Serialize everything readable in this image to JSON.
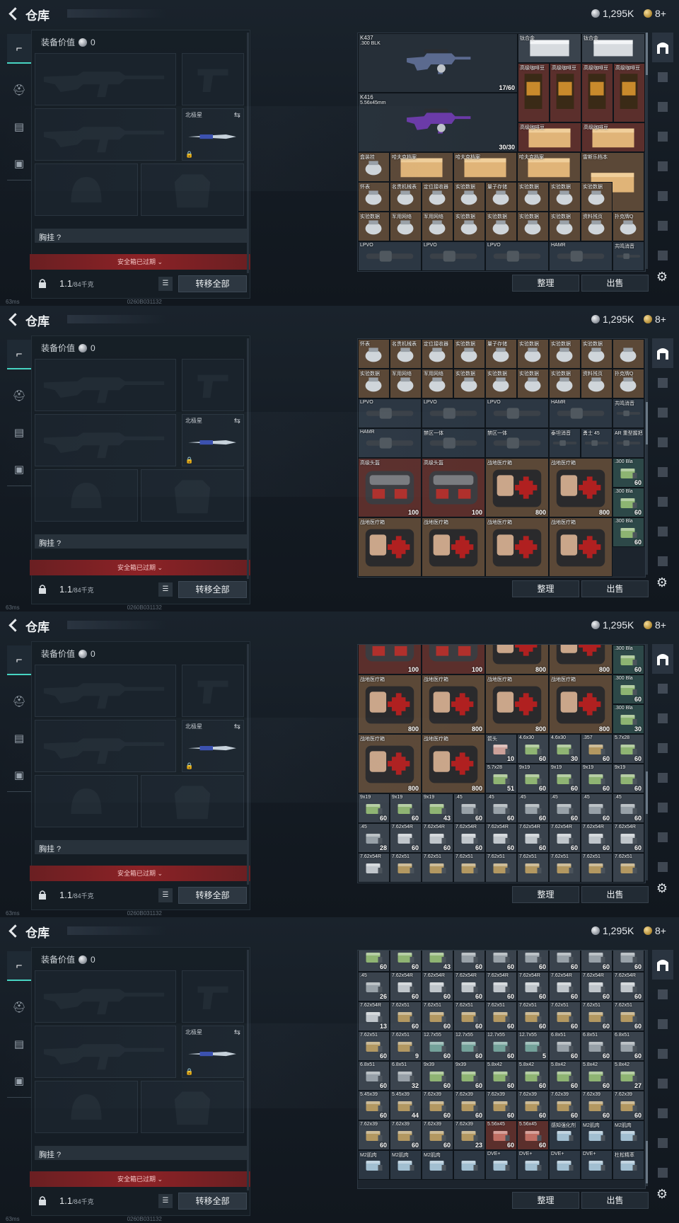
{
  "topbar": {
    "title": "仓库",
    "silver": "1,295K",
    "gold": "8+"
  },
  "left": {
    "equip_value_label": "装备价值",
    "equip_value": "0",
    "secondary_slot_label": "北极星",
    "vest_label": "胸挂 ?",
    "safe_box": "安全箱已过期",
    "weight": "1.1",
    "weight_max": "/84千克",
    "transfer_all": "转移全部"
  },
  "status": {
    "ping": "63ms",
    "uid": "0260B031132"
  },
  "buttons": {
    "sort": "整理",
    "sell": "出售"
  },
  "panels": [
    {
      "scroll_pos": 0.0,
      "cells": [
        {
          "c": 0,
          "r": 0,
          "w": 5,
          "h": 4,
          "t": "K437",
          "s": ".300 BLK",
          "n": "17/60",
          "k": "weapon"
        },
        {
          "c": 0,
          "r": 4,
          "w": 5,
          "h": 4,
          "t": "K416",
          "s": "5.56x45mm",
          "n": "30/30",
          "k": "weapon"
        },
        {
          "c": 5,
          "r": 0,
          "w": 2,
          "h": 1,
          "t": "钛合金",
          "k": "grey"
        },
        {
          "c": 7,
          "r": 0,
          "w": 2,
          "h": 1,
          "t": "钛合金",
          "k": "grey"
        },
        {
          "c": 5,
          "r": 1,
          "w": 1,
          "h": 2,
          "t": "高级咖啡豆",
          "k": "red"
        },
        {
          "c": 6,
          "r": 1,
          "w": 1,
          "h": 2,
          "t": "高级咖啡豆",
          "k": "red"
        },
        {
          "c": 7,
          "r": 1,
          "w": 1,
          "h": 2,
          "t": "高级咖啡豆",
          "k": "red"
        },
        {
          "c": 8,
          "r": 1,
          "w": 1,
          "h": 2,
          "t": "高级咖啡豆",
          "k": "red"
        },
        {
          "c": 5,
          "r": 3,
          "w": 2,
          "h": 1,
          "t": "高级咖啡豆",
          "k": "red"
        },
        {
          "c": 7,
          "r": 3,
          "w": 2,
          "h": 1,
          "t": "高级咖啡豆",
          "k": "red"
        },
        {
          "c": 0,
          "r": 4,
          "w": 1,
          "h": 1,
          "t": "",
          "k": "none"
        },
        {
          "c": 0,
          "r": 5,
          "w": 1,
          "h": 1,
          "t": "盒装挂",
          "k": "brown"
        },
        {
          "c": 1,
          "r": 5,
          "w": 2,
          "h": 1,
          "t": "哈夫克档案",
          "k": "brown"
        },
        {
          "c": 3,
          "r": 5,
          "w": 2,
          "h": 1,
          "t": "哈夫克档案",
          "k": "brown"
        },
        {
          "c": 5,
          "r": 5,
          "w": 2,
          "h": 1,
          "t": "哈夫克档案",
          "k": "brown"
        },
        {
          "c": 7,
          "r": 5,
          "w": 1,
          "h": 2,
          "t": "雷斯乐档本",
          "k": "brown"
        }
      ]
    }
  ],
  "panel_rows": [
    [
      {
        "c": 0,
        "r": 6,
        "t": "怀表",
        "k": "brown"
      },
      {
        "c": 1,
        "r": 6,
        "t": "名贵机械表",
        "k": "brown"
      },
      {
        "c": 2,
        "r": 6,
        "t": "定位接收器",
        "k": "brown"
      },
      {
        "c": 3,
        "r": 6,
        "t": "实验数据",
        "k": "brown"
      },
      {
        "c": 4,
        "r": 6,
        "t": "量子存储",
        "k": "brown"
      },
      {
        "c": 5,
        "r": 6,
        "t": "实验数据",
        "k": "brown"
      },
      {
        "c": 6,
        "r": 6,
        "t": "实验数据",
        "k": "brown"
      },
      {
        "c": 7,
        "r": 6,
        "t": "实验数据",
        "k": "brown"
      },
      {
        "c": 0,
        "r": 7,
        "t": "实验数据",
        "k": "brown"
      },
      {
        "c": 1,
        "r": 7,
        "t": "军用网络",
        "k": "brown"
      },
      {
        "c": 2,
        "r": 7,
        "t": "军用网络",
        "k": "brown"
      },
      {
        "c": 3,
        "r": 7,
        "t": "实验数据",
        "k": "brown"
      },
      {
        "c": 4,
        "r": 7,
        "t": "实验数据",
        "k": "brown"
      },
      {
        "c": 5,
        "r": 7,
        "t": "实验数据",
        "k": "brown"
      },
      {
        "c": 6,
        "r": 7,
        "t": "实验数据",
        "k": "brown"
      },
      {
        "c": 7,
        "r": 7,
        "t": "资料残页",
        "k": "brown"
      },
      {
        "c": 8,
        "r": 7,
        "t": "扑克牌Q",
        "k": "brown"
      },
      {
        "c": 0,
        "r": 8,
        "t": "LPVO",
        "k": "blue"
      },
      {
        "c": 2,
        "r": 8,
        "t": "LPVO",
        "k": "blue"
      },
      {
        "c": 4,
        "r": 8,
        "t": "LPVO",
        "k": "blue"
      },
      {
        "c": 6,
        "r": 8,
        "t": "HAMR",
        "k": "blue"
      },
      {
        "c": 8,
        "r": 8,
        "t": "共鸣消音",
        "k": "blue"
      }
    ]
  ],
  "p2": {
    "rows": [
      {
        "r": 0,
        "items": [
          [
            "怀表",
            "brown"
          ],
          [
            "名贵机械表",
            "brown"
          ],
          [
            "定位接收器",
            "brown"
          ],
          [
            "实验数据",
            "brown"
          ],
          [
            "量子存储",
            "brown"
          ],
          [
            "实验数据",
            "brown"
          ],
          [
            "实验数据",
            "brown"
          ],
          [
            "实验数据",
            "brown"
          ],
          [
            "",
            "brown"
          ]
        ]
      },
      {
        "r": 1,
        "items": [
          [
            "实验数据",
            "brown"
          ],
          [
            "军用网络",
            "brown"
          ],
          [
            "军用网络",
            "brown"
          ],
          [
            "实验数据",
            "brown"
          ],
          [
            "实验数据",
            "brown"
          ],
          [
            "实验数据",
            "brown"
          ],
          [
            "实验数据",
            "brown"
          ],
          [
            "资料残页",
            "brown"
          ],
          [
            "扑克牌Q",
            "brown"
          ]
        ]
      }
    ],
    "row2": [
      [
        "LPVO",
        0
      ],
      [
        "LPVO",
        2
      ],
      [
        "LPVO",
        4
      ],
      [
        "HAMR",
        6
      ],
      [
        "共鸣消音",
        8
      ]
    ],
    "row3": [
      [
        "HAMR",
        0
      ],
      [
        "禁区一体",
        2
      ],
      [
        "禁区一体",
        4
      ],
      [
        "泰坦消音",
        6
      ],
      [
        "勇士 45",
        7
      ],
      [
        "AR 重型握把",
        8
      ]
    ],
    "helmets": [
      [
        "高级头盔",
        "100"
      ],
      [
        "高级头盔",
        "100"
      ]
    ],
    "meds": [
      [
        "战地医疗箱",
        "800"
      ],
      [
        "战地医疗箱",
        "800"
      ]
    ],
    "meds2": [
      [
        "战地医疗箱",
        ""
      ],
      [
        "战地医疗箱",
        ""
      ],
      [
        "战地医疗箱",
        ""
      ],
      [
        "战地医疗箱",
        ""
      ]
    ],
    "ammo": [
      [
        ".300 Bla",
        "60"
      ],
      [
        ".300 Bla",
        "60"
      ],
      [
        ".300 Bla",
        "60"
      ]
    ]
  },
  "p3": {
    "medrow1": [
      [
        "",
        "100"
      ],
      [
        "",
        "100"
      ],
      [
        "",
        "800"
      ],
      [
        "",
        "800"
      ]
    ],
    "medrow2": [
      [
        "战地医疗箱",
        "800"
      ],
      [
        "战地医疗箱",
        "800"
      ],
      [
        "战地医疗箱",
        "800"
      ],
      [
        "战地医疗箱",
        "800"
      ]
    ],
    "medrow3": [
      [
        "战地医疗箱",
        "800"
      ],
      [
        "战地医疗箱",
        "800"
      ]
    ],
    "ammo_right": [
      [
        ".300 Bla",
        "60"
      ],
      [
        ".300 Bla",
        "60"
      ],
      [
        ".300 Bla",
        "30"
      ]
    ],
    "smallA": [
      [
        "箭头",
        "10",
        "pink"
      ],
      [
        "4.6x30",
        "60",
        "green"
      ],
      [
        "4.6x30",
        "30",
        "green"
      ],
      [
        ".357",
        "60",
        "tan"
      ],
      [
        "5.7x28",
        "60",
        "green"
      ]
    ],
    "smallB": [
      [
        "5.7x28",
        "51",
        "green"
      ],
      [
        "9x19",
        "60",
        "green"
      ],
      [
        "9x19",
        "60",
        "green"
      ],
      [
        "9x19",
        "60",
        "green"
      ],
      [
        "9x19",
        "60",
        "green"
      ]
    ],
    "smallC": [
      [
        "9x19",
        "60",
        "green"
      ],
      [
        "9x19",
        "60",
        "green"
      ],
      [
        "9x19",
        "43",
        "green"
      ],
      [
        ".45",
        "60",
        "grey"
      ],
      [
        ".45",
        "60",
        "grey"
      ],
      [
        ".45",
        "60",
        "grey"
      ],
      [
        ".45",
        "60",
        "grey"
      ],
      [
        ".45",
        "60",
        "grey"
      ],
      [
        ".45",
        "60",
        "grey"
      ]
    ],
    "smallD": [
      [
        ".45",
        "28",
        "grey"
      ],
      [
        "7.62x54R",
        "60",
        "white"
      ],
      [
        "7.62x54R",
        "60",
        "white"
      ],
      [
        "7.62x54R",
        "60",
        "white"
      ],
      [
        "7.62x54R",
        "60",
        "white"
      ],
      [
        "7.62x54R",
        "60",
        "white"
      ],
      [
        "7.62x54R",
        "60",
        "white"
      ],
      [
        "7.62x54R",
        "60",
        "white"
      ],
      [
        "7.62x54R",
        "60",
        "white"
      ]
    ],
    "smallE": [
      [
        "7.62x54R",
        "",
        "white"
      ],
      [
        "7.62x51",
        "",
        "tan"
      ],
      [
        "7.62x51",
        "",
        "tan"
      ],
      [
        "7.62x51",
        "",
        "tan"
      ],
      [
        "7.62x51",
        "",
        "tan"
      ],
      [
        "7.62x51",
        "",
        "tan"
      ],
      [
        "7.62x51",
        "",
        "tan"
      ],
      [
        "7.62x51",
        "",
        "tan"
      ],
      [
        "7.62x51",
        "",
        "tan"
      ]
    ]
  },
  "p4": {
    "rows": [
      [
        [
          "9x19",
          "60",
          "green"
        ],
        [
          "9x19",
          "60",
          "green"
        ],
        [
          "9x19",
          "43",
          "green"
        ],
        [
          ".45",
          "60",
          "grey"
        ],
        [
          ".45",
          "60",
          "grey"
        ],
        [
          ".45",
          "60",
          "grey"
        ],
        [
          ".45",
          "60",
          "grey"
        ],
        [
          ".45",
          "60",
          "grey"
        ],
        [
          ".45",
          "60",
          "grey"
        ]
      ],
      [
        [
          ".45",
          "26",
          "grey"
        ],
        [
          "7.62x54R",
          "60",
          "white"
        ],
        [
          "7.62x54R",
          "60",
          "white"
        ],
        [
          "7.62x54R",
          "60",
          "white"
        ],
        [
          "7.62x54R",
          "60",
          "white"
        ],
        [
          "7.62x54R",
          "60",
          "white"
        ],
        [
          "7.62x54R",
          "60",
          "white"
        ],
        [
          "7.62x54R",
          "60",
          "white"
        ],
        [
          "7.62x54R",
          "60",
          "white"
        ]
      ],
      [
        [
          "7.62x54R",
          "13",
          "white"
        ],
        [
          "7.62x51",
          "60",
          "tan"
        ],
        [
          "7.62x51",
          "60",
          "tan"
        ],
        [
          "7.62x51",
          "60",
          "tan"
        ],
        [
          "7.62x51",
          "60",
          "tan"
        ],
        [
          "7.62x51",
          "60",
          "tan"
        ],
        [
          "7.62x51",
          "60",
          "tan"
        ],
        [
          "7.62x51",
          "60",
          "tan"
        ],
        [
          "7.62x51",
          "60",
          "tan"
        ]
      ],
      [
        [
          "7.62x51",
          "60",
          "tan"
        ],
        [
          "7.62x51",
          "9",
          "tan"
        ],
        [
          "12.7x55",
          "60",
          "teal"
        ],
        [
          "12.7x55",
          "60",
          "teal"
        ],
        [
          "12.7x55",
          "60",
          "teal"
        ],
        [
          "12.7x55",
          "5",
          "teal"
        ],
        [
          "6.8x51",
          "60",
          "grey"
        ],
        [
          "6.8x51",
          "60",
          "grey"
        ],
        [
          "6.8x51",
          "60",
          "grey"
        ]
      ],
      [
        [
          "6.8x51",
          "60",
          "grey"
        ],
        [
          "6.8x51",
          "32",
          "grey"
        ],
        [
          "9x39",
          "60",
          "green"
        ],
        [
          "9x39",
          "60",
          "green"
        ],
        [
          "5.8x42",
          "60",
          "green"
        ],
        [
          "5.8x42",
          "60",
          "green"
        ],
        [
          "5.8x42",
          "60",
          "green"
        ],
        [
          "5.8x42",
          "60",
          "green"
        ],
        [
          "5.8x42",
          "27",
          "green"
        ]
      ],
      [
        [
          "5.45x39",
          "60",
          "tan"
        ],
        [
          "5.45x39",
          "44",
          "tan"
        ],
        [
          "7.62x39",
          "60",
          "tan"
        ],
        [
          "7.62x39",
          "60",
          "tan"
        ],
        [
          "7.62x39",
          "60",
          "tan"
        ],
        [
          "7.62x39",
          "60",
          "tan"
        ],
        [
          "7.62x39",
          "60",
          "tan"
        ],
        [
          "7.62x39",
          "60",
          "tan"
        ],
        [
          "7.62x39",
          "60",
          "tan"
        ]
      ],
      [
        [
          "7.62x39",
          "60",
          "tan"
        ],
        [
          "7.62x39",
          "60",
          "tan"
        ],
        [
          "7.62x39",
          "60",
          "tan"
        ],
        [
          "7.62x39",
          "23",
          "tan"
        ],
        [
          "5.56x45",
          "60",
          "red"
        ],
        [
          "5.56x45",
          "60",
          "red"
        ],
        [
          "感知强化剂",
          "",
          "blue"
        ],
        [
          "M2肌肉",
          "",
          "blue"
        ],
        [
          "M2肌肉",
          "",
          "blue"
        ]
      ],
      [
        [
          "M2肌肉",
          "",
          "blue"
        ],
        [
          "M2肌肉",
          "",
          "blue"
        ],
        [
          "M2肌肉",
          "",
          "blue"
        ],
        [
          "",
          "",
          "blue"
        ],
        [
          "DVE+",
          "",
          "blue"
        ],
        [
          "DVE+",
          "",
          "blue"
        ],
        [
          "DVE+",
          "",
          "blue"
        ],
        [
          "DVE+",
          "",
          "blue"
        ],
        [
          "杜松精萃",
          "",
          "blue"
        ]
      ]
    ]
  }
}
